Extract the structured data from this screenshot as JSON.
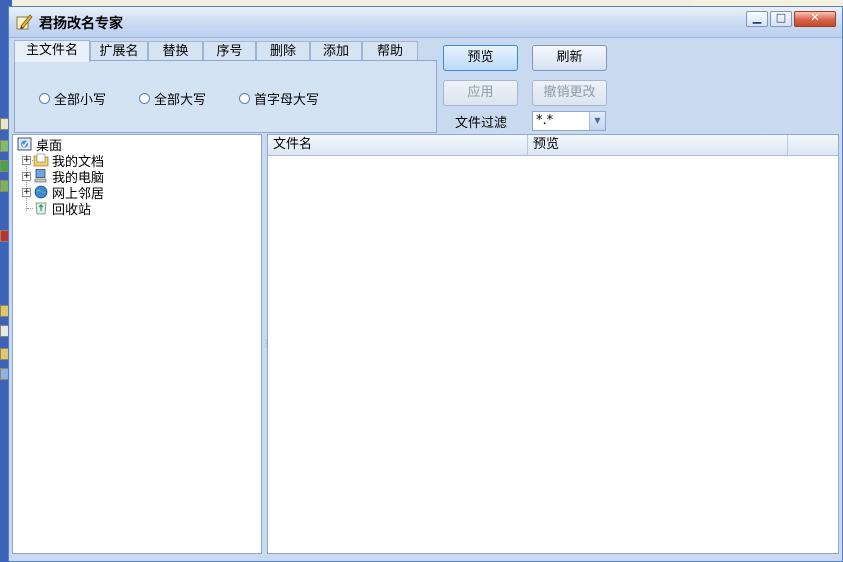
{
  "window": {
    "title": "君扬改名专家"
  },
  "tabs": [
    {
      "label": "主文件名",
      "active": true
    },
    {
      "label": "扩展名",
      "active": false
    },
    {
      "label": "替换",
      "active": false
    },
    {
      "label": "序号",
      "active": false
    },
    {
      "label": "删除",
      "active": false
    },
    {
      "label": "添加",
      "active": false
    },
    {
      "label": "帮助",
      "active": false
    }
  ],
  "case_options": [
    {
      "label": "全部小写",
      "checked": false
    },
    {
      "label": "全部大写",
      "checked": false
    },
    {
      "label": "首字母大写",
      "checked": false
    }
  ],
  "actions": {
    "preview": "预览",
    "refresh": "刷新",
    "apply": "应用",
    "undo": "撤销更改"
  },
  "filter": {
    "label": "文件过滤",
    "value": "*.*"
  },
  "tree": {
    "root": "桌面",
    "items": [
      {
        "label": "我的文档",
        "icon": "documents-folder-icon"
      },
      {
        "label": "我的电脑",
        "icon": "computer-icon"
      },
      {
        "label": "网上邻居",
        "icon": "network-icon"
      },
      {
        "label": "回收站",
        "icon": "recycle-bin-icon"
      }
    ]
  },
  "list": {
    "columns": [
      "文件名",
      "预览"
    ]
  },
  "colors": {
    "window_bg": "#c9daf0",
    "titlebar": "#c7d8f1",
    "close_button": "#d8644a"
  }
}
